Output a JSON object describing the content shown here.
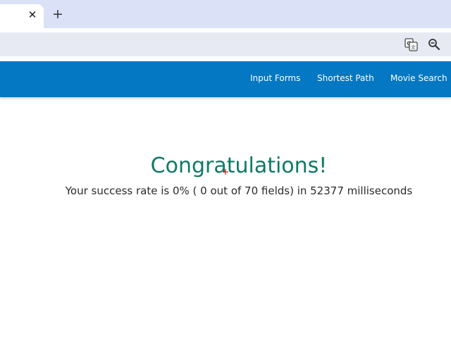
{
  "browser": {
    "tab_close_glyph": "✕",
    "new_tab_glyph": "+",
    "icons": [
      "close-icon",
      "plus-icon",
      "translate-icon",
      "zoom-out-icon"
    ]
  },
  "navbar": {
    "color": "#0478c2",
    "links": [
      "Input Forms",
      "Shortest Path",
      "Movie Search"
    ]
  },
  "main": {
    "heading": "Congratulations!",
    "heading_color": "#0e7a64",
    "result": "Your success rate is 0% ( 0 out of 70 fields) in 52377 milliseconds"
  }
}
